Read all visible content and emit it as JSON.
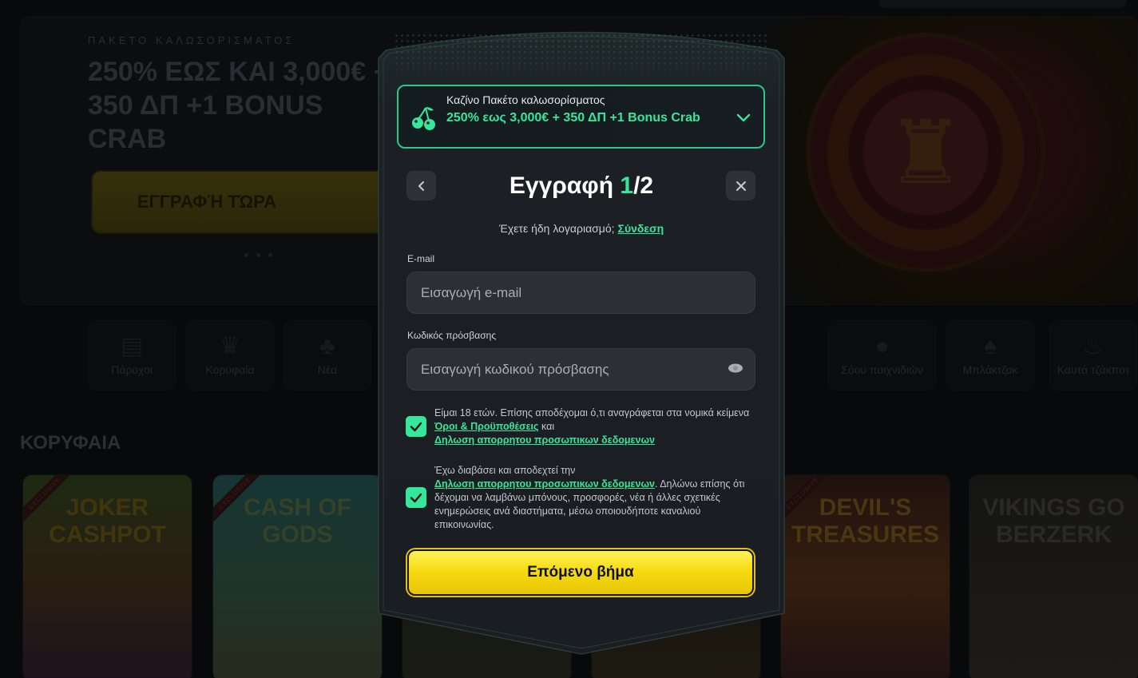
{
  "background": {
    "hero": {
      "kicker": "ΠΑΚΕΤΟ ΚΑΛΩΣΟΡΙΣΜΑΤΟΣ",
      "title": "250% ΕΩΣ ΚΑΙ 3,000€ + 350 ΔΠ +1 BONUS CRAB",
      "cta_label": "ΕΓΓΡΑΦΉ ΤΏΡΑ"
    },
    "categories": [
      {
        "label": "Πάροχοι",
        "icon": "book-icon"
      },
      {
        "label": "Κορυφαία",
        "icon": "crown-icon"
      },
      {
        "label": "Νέα",
        "icon": "clover-icon"
      },
      {
        "label": "Σόου παιχνιδιών",
        "icon": "microphone-icon"
      },
      {
        "label": "Μπλάκτζακ",
        "icon": "spade-icon"
      },
      {
        "label": "Καυτά τζάκποτ",
        "icon": "flame-icon"
      }
    ],
    "section_title": "ΚΟΡΥΦΑΙΑ",
    "games": [
      {
        "name": "JOKER CASHPOT",
        "tag": "EXCLUSIVE"
      },
      {
        "name": "CASH OF GODS",
        "tag": "EXCLUSIVE"
      },
      {
        "name": "DEVIL'S TREASURES",
        "tag": "EXCLUSIVE"
      },
      {
        "name": "VIKINGS GO BERZERK",
        "tag": ""
      }
    ]
  },
  "modal": {
    "promo": {
      "subtitle": "Καζίνο Πακέτο καλωσορίσματος",
      "title": "250% εως 3,000€ + 350 ΔΠ +1 Bonus Crab",
      "icon": "cherry-icon",
      "accent": "#35e79b"
    },
    "title_prefix": "Εγγραφή ",
    "step_current": "1",
    "step_total": "/2",
    "have_account_text": "Έχετε ήδη λογαριασμό;",
    "login_link": "Σύνδεση",
    "email": {
      "label": "E-mail",
      "placeholder": "Εισαγωγή e-mail",
      "value": ""
    },
    "password": {
      "label": "Κωδικός πρόσβασης",
      "placeholder": "Εισαγωγή κωδικού πρόσβασης",
      "value": ""
    },
    "consent_age": {
      "checked": true,
      "text_before": "Είμαι 18 ετών. Επίσης αποδέχομαι ό,τι αναγράφεται στα νομικά κείμενα ",
      "link_terms": "Όροι & Προϋποθέσεις",
      "text_mid": " και",
      "link_privacy": "Δηλωση απορρητου προσωπικων δεδομενων"
    },
    "consent_marketing": {
      "checked": true,
      "text_before": "Έχω διαβάσει και αποδεχτεί την",
      "link_privacy": "Δηλωση απορρητου προσωπικων δεδομενων",
      "text_after": ". Δηλώνω επίσης ότι δέχομαι να λαμβάνω μπόνους, προσφορές, νέα ή άλλες σχετικές ενημερώσεις ανά διαστήματα, μέσω οποιουδήποτε καναλιού επικοινωνίας."
    },
    "next_button": "Επόμενο βήμα",
    "colors": {
      "accent": "#35e79b",
      "button": "#f6dc10",
      "panel": "#1b1e23"
    }
  }
}
